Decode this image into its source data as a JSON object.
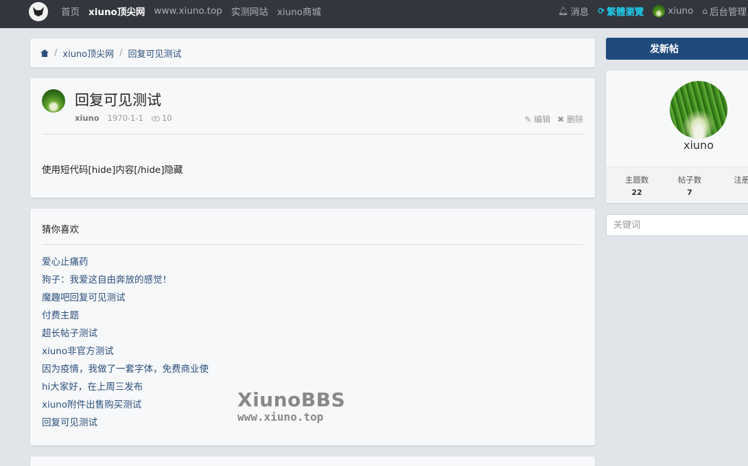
{
  "nav": {
    "left": [
      "首页",
      "xiuno顶尖网",
      "www.xiuno.top",
      "实测网站",
      "xiuno商城"
    ],
    "messages": "消息",
    "traditional": "繁體瀏覽",
    "user": "xiuno",
    "admin": "后台管理"
  },
  "breadcrumb": {
    "site": "xiuno顶尖网",
    "current": "回复可见测试"
  },
  "post": {
    "title": "回复可见测试",
    "author": "xiuno",
    "date": "1970-1-1",
    "views": "10",
    "edit": "编辑",
    "delete": "删除",
    "content": "使用短代码[hide]内容[/hide]隐藏"
  },
  "guess": {
    "heading": "猜你喜欢",
    "items": [
      "爱心止痛药",
      "狗子：我爱这自由奔放的感觉！",
      "魔趣吧回复可见测试",
      "付费主题",
      "超长帖子测试",
      "xiuno非官方测试",
      "因为疫情，我做了一套字体，免费商业使",
      "hi大家好，在上周三发布",
      "xiuno附件出售购买测试",
      "回复可见测试"
    ]
  },
  "sidebar": {
    "new_post": "发新帖",
    "username": "xiuno",
    "stats": [
      {
        "label": "主题数",
        "value": "22"
      },
      {
        "label": "帖子数",
        "value": "7"
      },
      {
        "label": "注册",
        "value": ""
      }
    ],
    "search_placeholder": "关键词"
  },
  "watermark": {
    "title": "XiunoBBS",
    "url": "www.xiuno.top"
  }
}
